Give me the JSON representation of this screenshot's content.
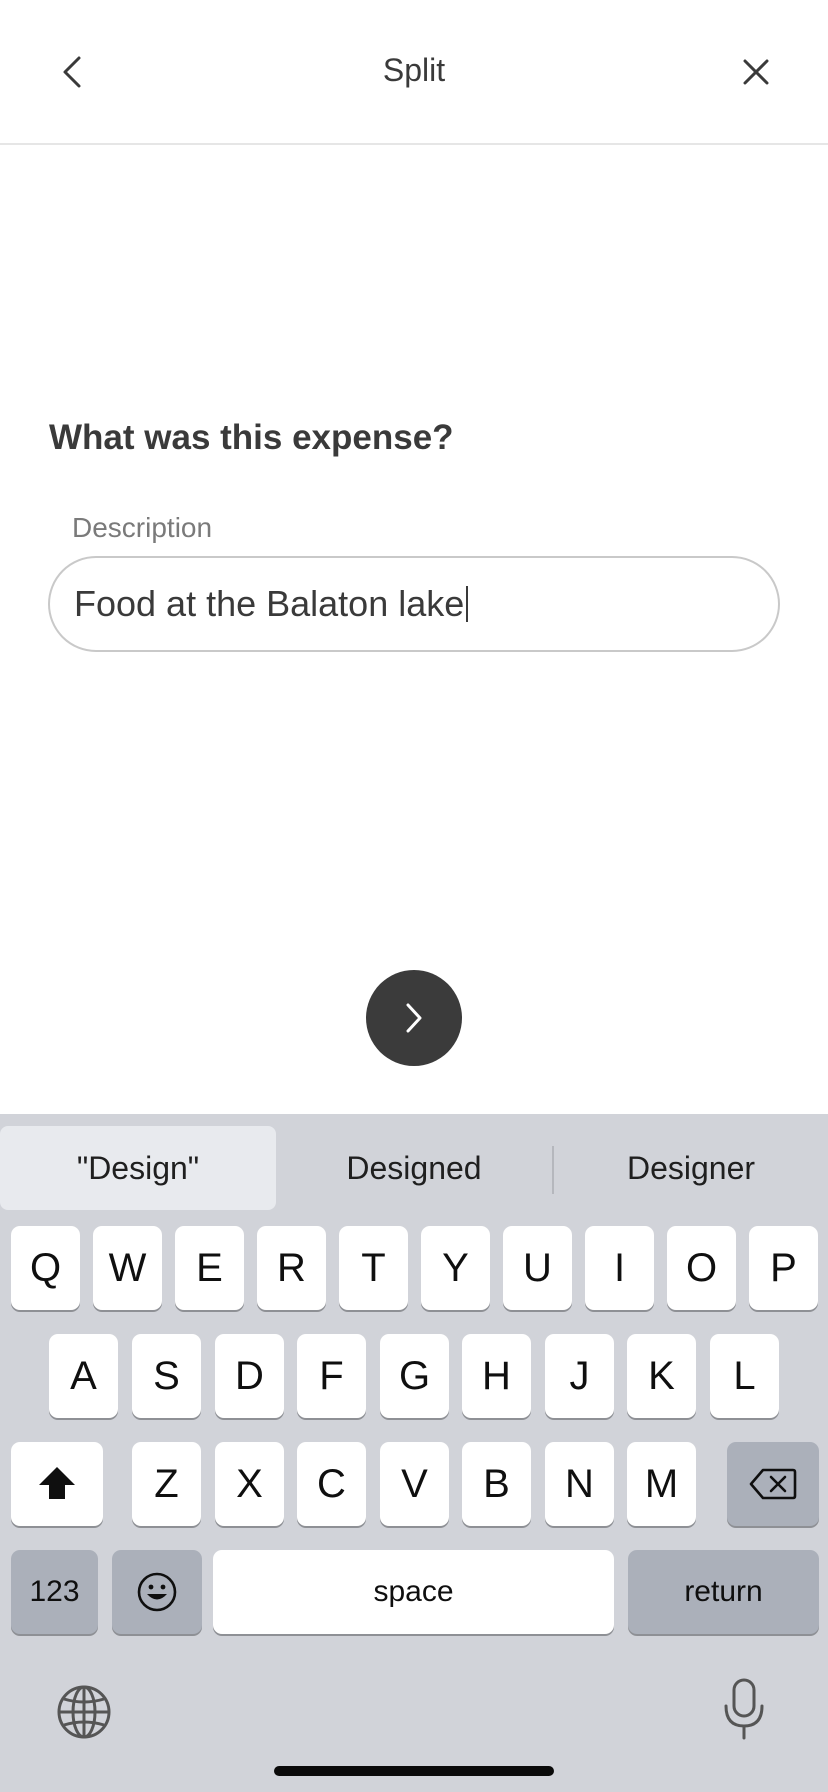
{
  "header": {
    "title": "Split",
    "back_icon": "chevron-left-icon",
    "close_icon": "close-icon"
  },
  "main": {
    "question": "What was this expense?",
    "description_label": "Description",
    "description_value": "Food at the Balaton lake",
    "next_icon": "chevron-right-icon"
  },
  "keyboard": {
    "suggestions": [
      "\"Design\"",
      "Designed",
      "Designer"
    ],
    "row1": [
      "Q",
      "W",
      "E",
      "R",
      "T",
      "Y",
      "U",
      "I",
      "O",
      "P"
    ],
    "row2": [
      "A",
      "S",
      "D",
      "F",
      "G",
      "H",
      "J",
      "K",
      "L"
    ],
    "row3": [
      "Z",
      "X",
      "C",
      "V",
      "B",
      "N",
      "M"
    ],
    "numbers_label": "123",
    "space_label": "space",
    "return_label": "return",
    "shift_icon": "shift-icon",
    "delete_icon": "backspace-icon",
    "emoji_icon": "emoji-icon",
    "globe_icon": "globe-icon",
    "mic_icon": "microphone-icon"
  },
  "colors": {
    "keyboard_bg": "#d1d3d9",
    "key_bg": "#ffffff",
    "dark_key_bg": "#abb0ba",
    "next_button_bg": "#3b3b3b"
  }
}
